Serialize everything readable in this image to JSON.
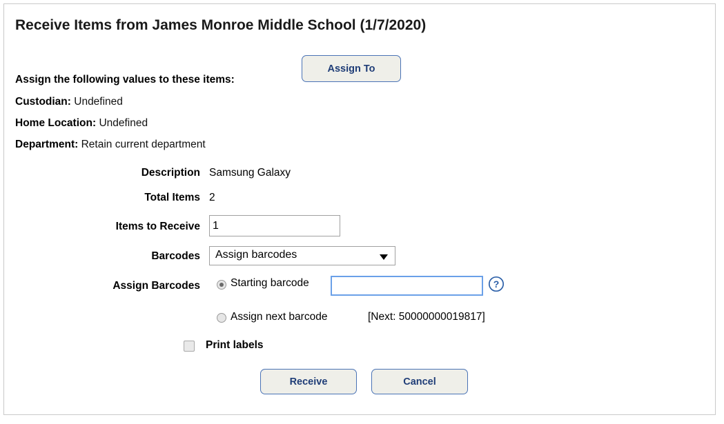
{
  "page": {
    "title": "Receive Items from James Monroe Middle School (1/7/2020)"
  },
  "assign_section": {
    "heading": "Assign the following values to these items:",
    "assign_to_button": "Assign To",
    "rows": [
      {
        "label": "Custodian:",
        "value": "Undefined"
      },
      {
        "label": "Home Location:",
        "value": "Undefined"
      },
      {
        "label": "Department:",
        "value": "Retain current department"
      }
    ]
  },
  "form": {
    "description": {
      "label": "Description",
      "value": "Samsung Galaxy"
    },
    "total_items": {
      "label": "Total Items",
      "value": "2"
    },
    "items_to_receive": {
      "label": "Items to Receive",
      "value": "1"
    },
    "barcodes": {
      "label": "Barcodes",
      "selected": "Assign barcodes",
      "options": [
        "Assign barcodes"
      ]
    },
    "assign_barcodes": {
      "label": "Assign Barcodes",
      "starting_option": "Starting barcode",
      "starting_value": "",
      "starting_selected": true,
      "next_option": "Assign next barcode",
      "next_selected": false,
      "next_hint": "[Next: 50000000019817]",
      "help_icon": "question-mark-icon"
    },
    "print_labels": {
      "label": "Print labels",
      "checked": false
    }
  },
  "actions": {
    "receive": "Receive",
    "cancel": "Cancel"
  },
  "colors": {
    "button_border": "#4972b5",
    "button_text": "#1f3d77",
    "button_fill": "#efefe9",
    "focus_border": "#6aa0e8",
    "page_border": "#c9c9c9"
  }
}
